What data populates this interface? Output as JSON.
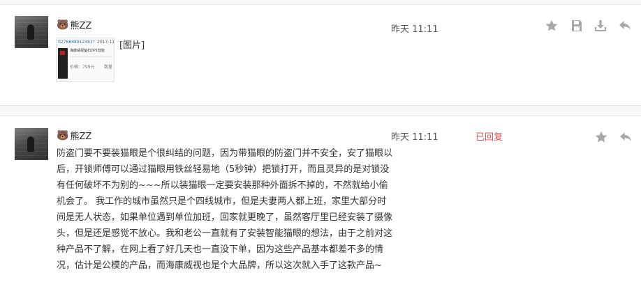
{
  "comments": [
    {
      "user": "熊ZZ",
      "avatar_icon": "user-avatar-photo",
      "time": "昨天 11:11",
      "image_label": "[图片]",
      "image_thumb": {
        "order_no": "0276898012383?",
        "date": "2017-11",
        "title": "海康威视萤石DP1智能",
        "price": "价格：799元",
        "qty": "数量"
      },
      "actions": [
        "star-icon",
        "save-icon",
        "download-icon",
        "reply-icon"
      ]
    },
    {
      "user": "熊ZZ",
      "avatar_icon": "user-avatar-photo",
      "time": "昨天 11:11",
      "status": "已回复",
      "status_color": "#d9534f",
      "text": "防盗门要不要装猫眼是个很纠结的问题，因为带猫眼的防盗门并不安全，安了猫眼以后，开锁师傅可以通过猫眼用铁丝轻易地（5秒钟）把锁打开，而且灵异的是对锁没有任何破坏不为别的~~~所以装猫眼一定要安装那种外面拆不掉的，不然就给小偷机会了。 我工作的城市虽然只是个四线城市，但是夫妻两人都上班，家里大部分时间是无人状态，如果单位遇到单位加班，回家就更晚了，虽然客厅里已经安装了摄像头，但是还是感觉不放心。我和老公一直就有了安装智能猫眼的想法，由于之前对这种产品不了解，在网上看了好几天也一直没下单，因为这些产品基本都差不多的情况，估计是公模的产品，而海康威视也是个大品牌，所以这次就入手了这款产品~",
      "actions": [
        "star-icon",
        "reply-icon"
      ]
    }
  ],
  "colors": {
    "icon": "#a8a8a8",
    "divider": "#e6e6e6",
    "band": "#f7f7f7"
  }
}
